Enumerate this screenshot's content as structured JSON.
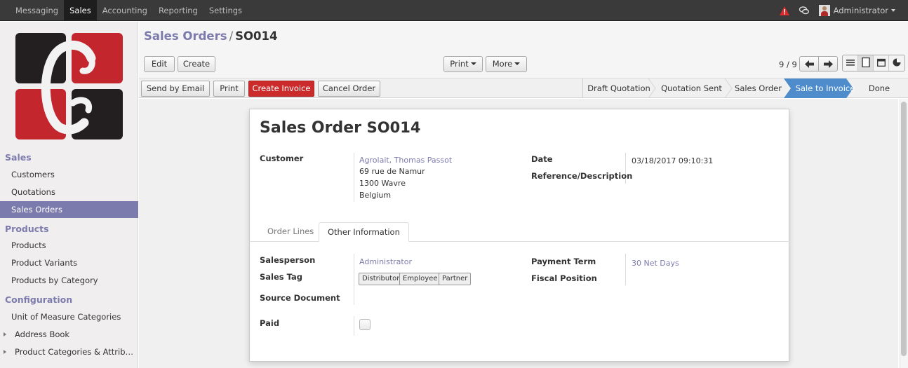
{
  "topbar": {
    "menu": [
      "Messaging",
      "Sales",
      "Accounting",
      "Reporting",
      "Settings"
    ],
    "active": "Sales",
    "user": "Administrator"
  },
  "sidebar": {
    "sections": [
      {
        "title": "Sales",
        "items": [
          "Customers",
          "Quotations",
          "Sales Orders"
        ]
      },
      {
        "title": "Products",
        "items": [
          "Products",
          "Product Variants",
          "Products by Category"
        ]
      },
      {
        "title": "Configuration",
        "items": [
          "Unit of Measure Categories",
          "Address Book",
          "Product Categories & Attrib…"
        ]
      }
    ],
    "active_item": "Sales Orders"
  },
  "breadcrumb": {
    "parent": "Sales Orders",
    "separator": "/",
    "current": "SO014"
  },
  "toolbar": {
    "edit": "Edit",
    "create": "Create",
    "print": "Print",
    "more": "More",
    "pager": "9 / 9"
  },
  "statusbar": {
    "buttons": {
      "send_email": "Send by Email",
      "print": "Print",
      "create_invoice": "Create Invoice",
      "cancel_order": "Cancel Order"
    },
    "stages": [
      "Draft Quotation",
      "Quotation Sent",
      "Sales Order",
      "Sale to Invoice",
      "Done"
    ],
    "active_stage": "Sale to Invoice"
  },
  "form": {
    "title_prefix": "Sales Order",
    "title_ref": "SO014",
    "customer_label": "Customer",
    "customer_name": "Agrolait, Thomas Passot",
    "customer_address": [
      "69 rue de Namur",
      "1300 Wavre",
      "Belgium"
    ],
    "date_label": "Date",
    "date_value": "03/18/2017 09:10:31",
    "reference_label": "Reference/Description",
    "tabs": [
      "Order Lines",
      "Other Information"
    ],
    "active_tab": "Other Information",
    "salesperson_label": "Salesperson",
    "salesperson_value": "Administrator",
    "sales_tag_label": "Sales Tag",
    "sales_tags": [
      "Distributor",
      "Employee",
      "Partner"
    ],
    "source_document_label": "Source Document",
    "payment_term_label": "Payment Term",
    "payment_term_value": "30 Net Days",
    "fiscal_position_label": "Fiscal Position",
    "paid_label": "Paid",
    "paid_checked": false
  },
  "colors": {
    "accent": "#7c7bad",
    "primary_button": "#cc2b2b",
    "active_stage": "#4e8ccb",
    "topbar": "#3a3a3a"
  }
}
